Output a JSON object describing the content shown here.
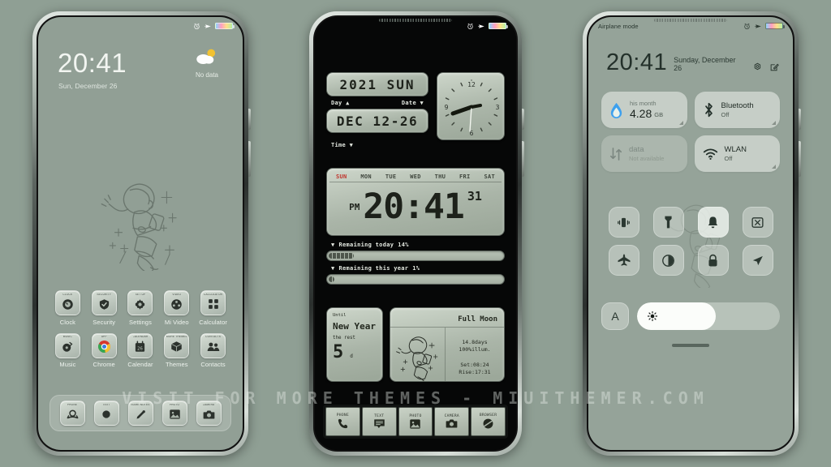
{
  "theme": {
    "bg_color": "#8f9f94",
    "accent_red": "#c0332c",
    "lcd_color": "#aab5a8"
  },
  "watermark": "VISIT  FOR  MORE  THEMES  -  MIUITHEMER.COM",
  "phone1": {
    "statusbar": {
      "alarm": "alarm-icon",
      "airplane": "airplane-icon",
      "battery": "battery-icon"
    },
    "lock": {
      "time": "20:41",
      "date": "Sun, December 26",
      "weather_label": "No data"
    },
    "apps": [
      {
        "mini": "CLOCK",
        "name": "Clock",
        "icon": "clock-icon"
      },
      {
        "mini": "SECURITY",
        "name": "Security",
        "icon": "shield-check-icon"
      },
      {
        "mini": "SET UP",
        "name": "Settings",
        "icon": "gear-icon"
      },
      {
        "mini": "VIDEO",
        "name": "Mi Video",
        "icon": "film-reel-icon"
      },
      {
        "mini": "CALCULATOR",
        "name": "Calculator",
        "icon": "calculator-icon"
      },
      {
        "mini": "MUSIC",
        "name": "Music",
        "icon": "music-note-icon"
      },
      {
        "mini": "APP",
        "name": "Chrome",
        "icon": "chrome-icon"
      },
      {
        "mini": "CALENDAR",
        "name": "Calendar",
        "icon": "calendar-26-icon"
      },
      {
        "mini": "MORE THEMES",
        "name": "Themes",
        "icon": "themes-cube-icon"
      },
      {
        "mini": "CONTACTS",
        "name": "Contacts",
        "icon": "contacts-icon"
      }
    ],
    "dock": [
      {
        "mini": "PHONE",
        "icon": "phone-icon"
      },
      {
        "mini": "TEXT",
        "icon": "message-dot-icon"
      },
      {
        "mini": "SOME NOTES",
        "icon": "pencil-icon"
      },
      {
        "mini": "PHOTO",
        "icon": "photo-icon"
      },
      {
        "mini": "CAMERA",
        "icon": "camera-icon"
      }
    ]
  },
  "phone2": {
    "statusbar": {
      "alarm": "alarm-icon",
      "airplane": "airplane-icon",
      "battery": "battery-icon"
    },
    "year_widget": {
      "value": "2021  SUN"
    },
    "controls_row1": {
      "day_label": "Day",
      "day_arrow": "▲",
      "date_label": "Date",
      "date_arrow": "▼"
    },
    "date_widget": {
      "value": "DEC 12-26"
    },
    "time_label": {
      "label": "Time",
      "arrow": "▼"
    },
    "analog_clock": {
      "hour_marks": [
        "12",
        "3",
        "6",
        "9"
      ]
    },
    "clock_widget": {
      "days": [
        "SUN",
        "MON",
        "TUE",
        "WED",
        "THU",
        "FRI",
        "SAT"
      ],
      "active_day": "SUN",
      "meridiem": "PM",
      "time": "20:41",
      "seconds": "31"
    },
    "progress": [
      {
        "arrow": "▼",
        "label": "Remaining today",
        "value": "14%",
        "percent": 14
      },
      {
        "arrow": "▼",
        "label": "Remaining this year",
        "value": "1%",
        "percent": 1
      }
    ],
    "newyear": {
      "until": "Until",
      "title": "New Year",
      "rest_label": "the rest",
      "days": "5",
      "unit": "d"
    },
    "moon": {
      "title": "Full Moon",
      "age": "14.8days",
      "illum": "100%illum.",
      "set": "Set:08:24",
      "rise": "Rise:17:31"
    },
    "dock": [
      {
        "mini": "PHONE",
        "icon": "phone-icon"
      },
      {
        "mini": "TEXT",
        "icon": "message-icon"
      },
      {
        "mini": "PHOTO",
        "icon": "photo-icon"
      },
      {
        "mini": "CAMERA",
        "icon": "camera-icon"
      },
      {
        "mini": "BROWSER",
        "icon": "browser-icon"
      }
    ]
  },
  "phone3": {
    "statusbar": {
      "left": "Airplane mode",
      "alarm": "alarm-icon",
      "airplane": "airplane-icon",
      "battery": "battery-icon"
    },
    "header": {
      "time": "20:41",
      "date": "Sunday, December 26",
      "settings_icon": "gear-icon",
      "edit_icon": "edit-icon"
    },
    "big_tiles": [
      {
        "title": "his month",
        "sub": "",
        "value": "4.28",
        "unit": "GB",
        "icon": "data-drop-icon",
        "state": "on"
      },
      {
        "title": "Bluetooth",
        "sub": "Off",
        "icon": "bluetooth-icon",
        "state": "off"
      },
      {
        "title": "data",
        "sub": "Not available",
        "icon": "data-transfer-icon",
        "state": "dim"
      },
      {
        "title": "WLAN",
        "sub": "Off",
        "icon": "wifi-icon",
        "state": "off"
      }
    ],
    "round_tiles": [
      {
        "name": "vibrate",
        "icon": "vibrate-icon",
        "state": "off"
      },
      {
        "name": "flashlight",
        "icon": "flashlight-icon",
        "state": "off"
      },
      {
        "name": "ringer",
        "icon": "bell-icon",
        "state": "on"
      },
      {
        "name": "screenshot",
        "icon": "screenshot-icon",
        "state": "off"
      },
      {
        "name": "airplane",
        "icon": "airplane-icon",
        "state": "off"
      },
      {
        "name": "dark-mode",
        "icon": "contrast-icon",
        "state": "off"
      },
      {
        "name": "lock",
        "icon": "lock-icon",
        "state": "off"
      },
      {
        "name": "location",
        "icon": "location-icon",
        "state": "off"
      }
    ],
    "brightness": {
      "auto_label": "A",
      "icon": "sun-icon",
      "percent": 55
    }
  }
}
